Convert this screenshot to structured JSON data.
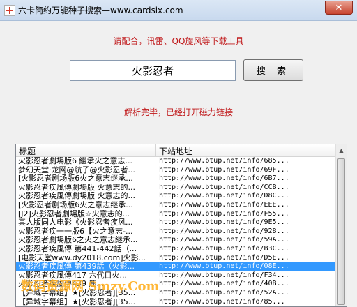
{
  "window": {
    "title": "六卡简约万能种子搜索—www.cardsix.com",
    "close_label": "✕"
  },
  "notices": {
    "top": "请配合，讯雷、QQ旋风等下载工具",
    "status": "解析完毕，已经打开磁力链接"
  },
  "search": {
    "value": "火影忍者",
    "button_label": "搜 索"
  },
  "list": {
    "columns": [
      "标题",
      "下站地址"
    ],
    "rows": [
      {
        "title": "火影忍者劇場版6 繼承火之意志...",
        "url": "http://www.btup.net/info/685..."
      },
      {
        "title": "梦幻天堂·龙网@航子@火影忍者...",
        "url": "http://www.btup.net/info/69F..."
      },
      {
        "title": "[火影忍者剧场版6火之意志继承...",
        "url": "http://www.btup.net/info/6B7..."
      },
      {
        "title": "火影忍者疾風傳劇場版 火意志的...",
        "url": "http://www.btup.net/info/CCB..."
      },
      {
        "title": "火影忍者疾風傳劇場版 火意志的...",
        "url": "http://www.btup.net/info/D8C..."
      },
      {
        "title": "[火影忍者剧场版6火之意志继承...",
        "url": "http://www.btup.net/info/EEE..."
      },
      {
        "title": "[J2]火影忍者劇場版☆火意志的...",
        "url": "http://www.btup.net/info/F55..."
      },
      {
        "title": "真人版同人电影《火影忍者疾风...",
        "url": "http://www.btup.net/info/9E5..."
      },
      {
        "title": "火影忍者疾一一版6【火之意志-...",
        "url": "http://www.btup.net/info/928..."
      },
      {
        "title": "火影忍者劇場版6之火之意志継承...",
        "url": "http://www.btup.net/info/59A..."
      },
      {
        "title": "火影忍者疾風傳 第441-442話（...",
        "url": "http://www.btup.net/info/B3C..."
      },
      {
        "title": "[电影天堂www.dy2018.com]火影...",
        "url": "http://www.btup.net/info/D5E..."
      },
      {
        "title": "火影忍者疾風傳 第439話（火影...",
        "url": "http://www.btup.net/info/08E...",
        "selected": true
      },
      {
        "title": "火影忍者疾風傳417 六代目火...",
        "url": "http://www.btup.net/info/F34..."
      },
      {
        "title": "火影忍者疾風傳439 鹿...",
        "url": "http://www.btup.net/info/40B..."
      },
      {
        "title": "【异域字幕组】★[火影忍者][35...",
        "url": "http://www.btup.net/info/52A..."
      },
      {
        "title": "【异域字幕组】★[火影忍者][35...",
        "url": "http://www.btup.net/info/85..."
      }
    ]
  },
  "watermark": "数码资源网 Smzy.Com",
  "colors": {
    "notice_red": "#c0181a",
    "selection_blue": "#3399ff"
  }
}
